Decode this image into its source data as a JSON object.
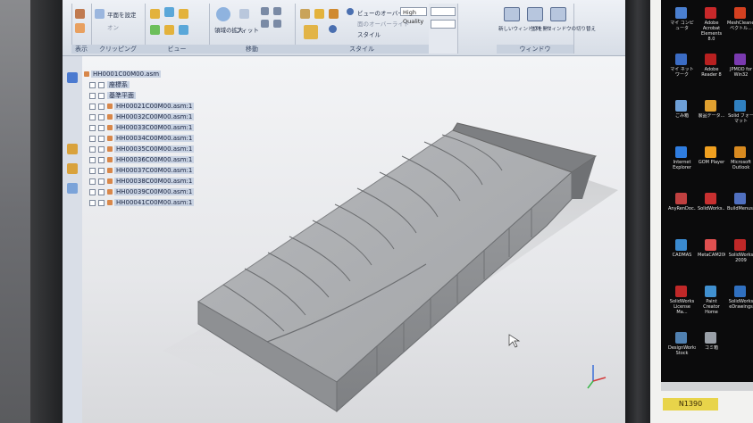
{
  "ribbon": {
    "clipping": {
      "label": "クリッピング",
      "plane_label": "平面を設定",
      "on_label": "オン"
    },
    "view": {
      "label": "ビュー"
    },
    "move": {
      "label": "移動",
      "zoom_label": "領域の拡大",
      "fit_label": "フィット"
    },
    "style": {
      "label": "スタイル",
      "override_label": "ビューのオーバーライド",
      "quality_value": "High Quality",
      "face_override_label": "面のオーバーライド",
      "style_label": "スタイル"
    },
    "window": {
      "label": "ウィンドウ",
      "new_window": "新しいウィンドウを開く",
      "arrange": "並列",
      "window_switch": "ウィンドウの切り替え"
    },
    "left_label": "表示"
  },
  "tree": {
    "root": "HH0001C00M00.asm",
    "items": [
      {
        "label": "座標系"
      },
      {
        "label": "基準平面"
      },
      {
        "label": "HH00021C00M00.asm:1"
      },
      {
        "label": "HH00032C00M00.asm:1"
      },
      {
        "label": "HH00033C00M00.asm:1"
      },
      {
        "label": "HH00034C00M00.asm:1"
      },
      {
        "label": "HH00035C00M00.asm:1"
      },
      {
        "label": "HH00036C00M00.asm:1"
      },
      {
        "label": "HH00037C00M00.asm:1"
      },
      {
        "label": "HH00038C00M00.asm:1"
      },
      {
        "label": "HH00039C00M00.asm:1"
      },
      {
        "label": "HH00041C00M00.asm:1"
      }
    ]
  },
  "desktop": {
    "icons": [
      {
        "label": "マイ コンピュータ",
        "color": "#4a7fd0"
      },
      {
        "label": "Adobe Acrobat Elements 8.0",
        "color": "#c8282a"
      },
      {
        "label": "MeshCleaner ベクトル...",
        "color": "#d44020"
      },
      {
        "label": "マイ ネットワーク",
        "color": "#3b6cc4"
      },
      {
        "label": "Adobe Reader 8",
        "color": "#b82020"
      },
      {
        "label": "JPMOD for Win32",
        "color": "#7a3ab0"
      },
      {
        "label": "ごみ箱",
        "color": "#6ea0d8"
      },
      {
        "label": "製品データ...",
        "color": "#e0a030"
      },
      {
        "label": "Solid フォーマット",
        "color": "#3080c0"
      },
      {
        "label": "Internet Explorer",
        "color": "#2f7de0"
      },
      {
        "label": "GOM Player",
        "color": "#f0a020"
      },
      {
        "label": "Microsoft Outlook",
        "color": "#d88a20"
      },
      {
        "label": "AnyRenDoc...",
        "color": "#c04040"
      },
      {
        "label": "SolidWorks...",
        "color": "#c83030"
      },
      {
        "label": "BuildMenus...",
        "color": "#5070c0"
      },
      {
        "label": "CADMAS",
        "color": "#3a8ad0"
      },
      {
        "label": "MetaCAM2008",
        "color": "#e05050"
      },
      {
        "label": "SolidWorks 2009",
        "color": "#c02828"
      },
      {
        "label": "SolidWorks License Ma...",
        "color": "#c02828"
      },
      {
        "label": "Paint Creator Home",
        "color": "#4090d0"
      },
      {
        "label": "SolidWorks eDrawings",
        "color": "#3070c0"
      },
      {
        "label": "DesignWorks Stock",
        "color": "#5080b0"
      },
      {
        "label": "ゴミ箱",
        "color": "#9aa0a8"
      }
    ],
    "tag": "N1390"
  },
  "colors": {
    "model_top": "#a9abae",
    "model_side": "#8f9194",
    "viewport_top": "#f3f4f6",
    "viewport_bottom": "#d8d9dc"
  }
}
